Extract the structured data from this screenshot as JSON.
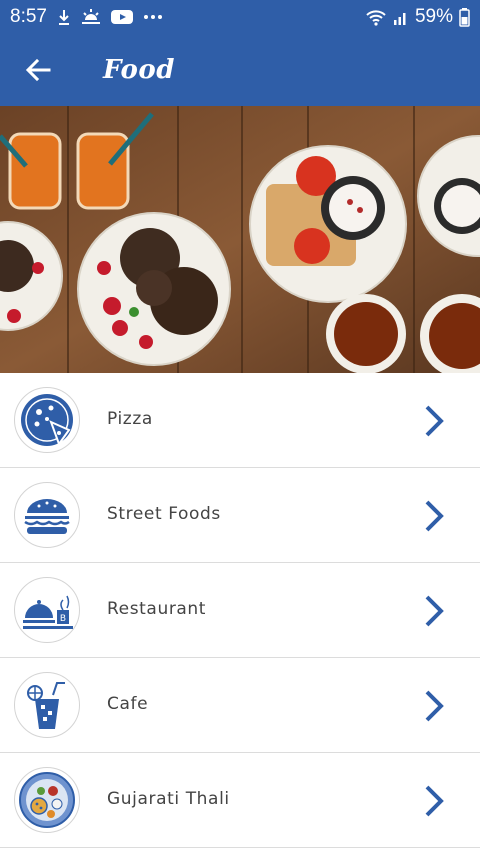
{
  "status_bar": {
    "time": "8:57",
    "battery": "59%",
    "icons": [
      "download-icon",
      "weather-icon",
      "youtube-icon",
      "more-icon",
      "wifi-icon",
      "signal-icon",
      "battery-icon"
    ]
  },
  "app_bar": {
    "title": "Food",
    "back_icon": "arrow-back-icon"
  },
  "colors": {
    "primary": "#2f5ea8",
    "chevron": "#2f5ea8",
    "divider": "#dcdcdc",
    "label": "#444444"
  },
  "categories": [
    {
      "label": "Pizza",
      "icon": "pizza-icon"
    },
    {
      "label": "Street Foods",
      "icon": "burger-icon"
    },
    {
      "label": "Restaurant",
      "icon": "restaurant-icon"
    },
    {
      "label": "Cafe",
      "icon": "cafe-drink-icon"
    },
    {
      "label": "Gujarati Thali",
      "icon": "thali-icon"
    }
  ]
}
